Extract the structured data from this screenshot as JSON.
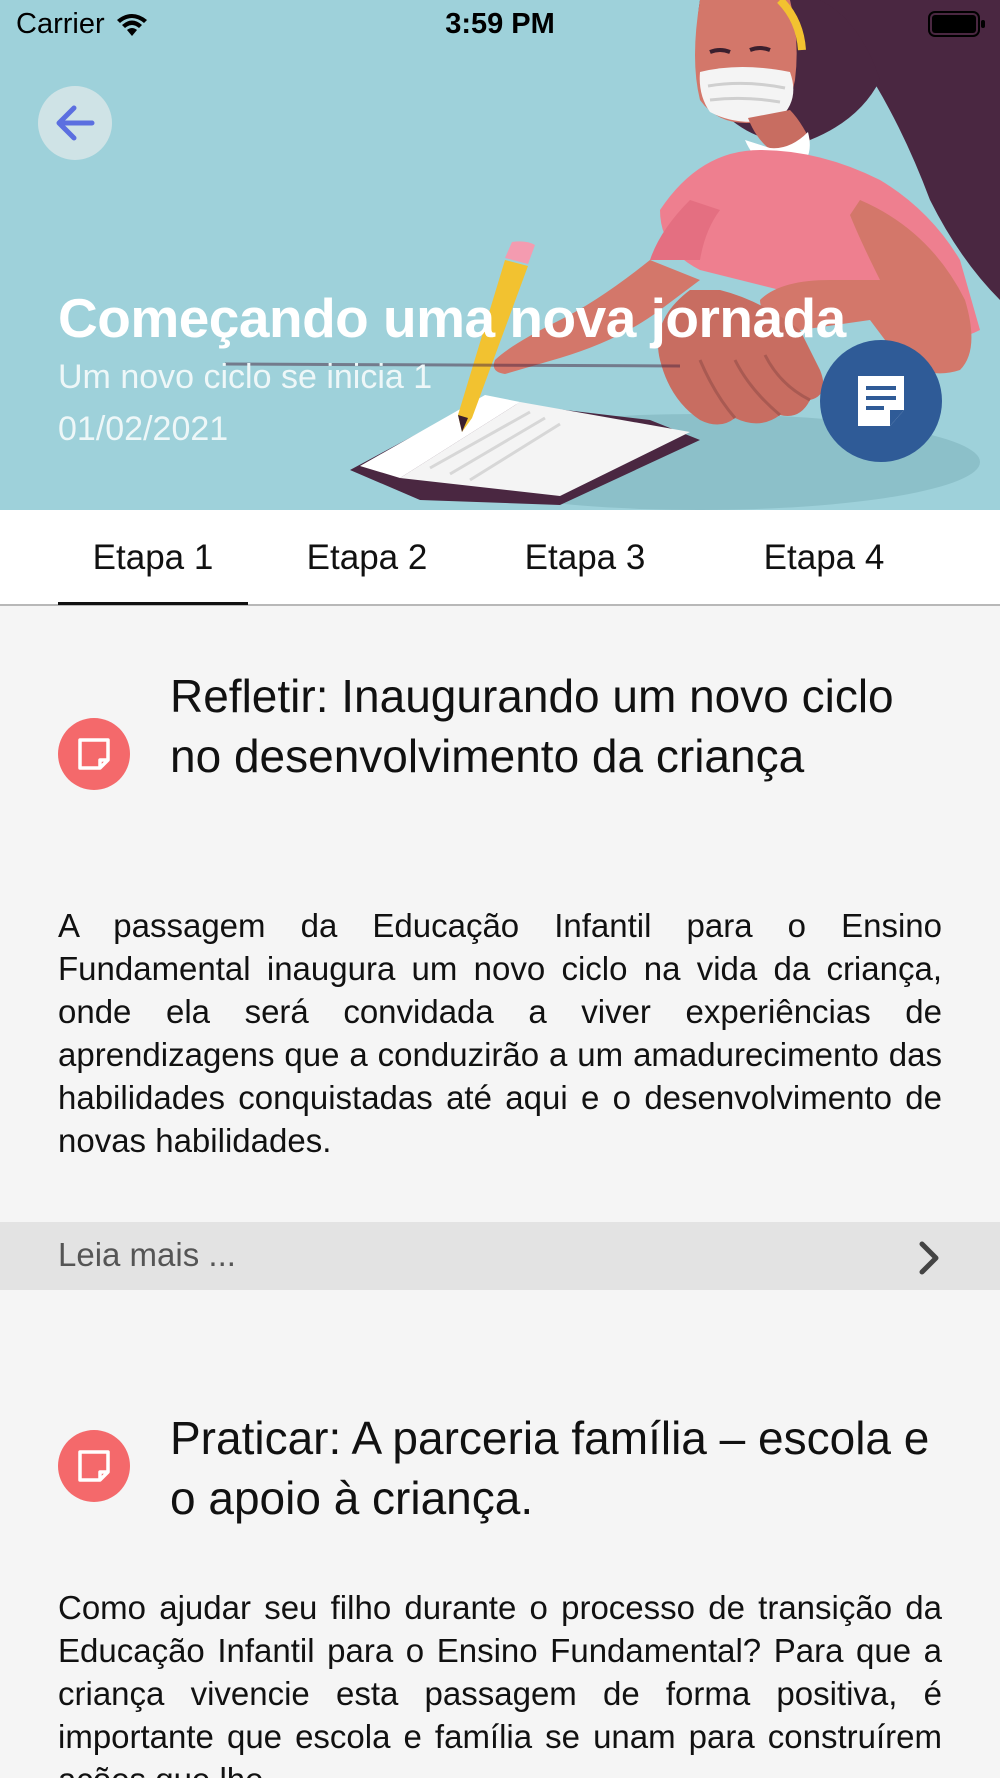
{
  "status_bar": {
    "carrier": "Carrier",
    "time": "3:59 PM"
  },
  "hero": {
    "title": "Começando uma nova jornada",
    "subtitle": "Um novo ciclo se inicia 1",
    "date": "01/02/2021",
    "background_color": "#9ed1da",
    "fab_color": "#2f5b97"
  },
  "tabs": [
    {
      "label": "Etapa 1",
      "selected": true
    },
    {
      "label": "Etapa 2",
      "selected": false
    },
    {
      "label": "Etapa 3",
      "selected": false
    },
    {
      "label": "Etapa 4",
      "selected": false
    }
  ],
  "sections": [
    {
      "icon": "note-icon",
      "title": "Refletir: Inaugurando um novo ciclo no desenvolvimento da criança",
      "body": "A passagem da Educação Infantil para o Ensino Fundamental inaugura um novo ciclo na vida da criança, onde ela será convidada a viver experiências de aprendizagens que a conduzirão a um amadurecimento das habilidades conquistadas até aqui e o desenvolvimento de novas habilidades.",
      "read_more": "Leia mais ..."
    },
    {
      "icon": "note-icon",
      "title": "Praticar: A parceria família – escola e o apoio à criança.",
      "body": "Como ajudar seu filho durante o processo de transição da Educação Infantil para o Ensino Fundamental? Para que a criança vivencie esta passagem de forma positiva, é importante que escola e família se unam para construírem ações que lhe"
    }
  ],
  "accent_color": "#f4696b"
}
